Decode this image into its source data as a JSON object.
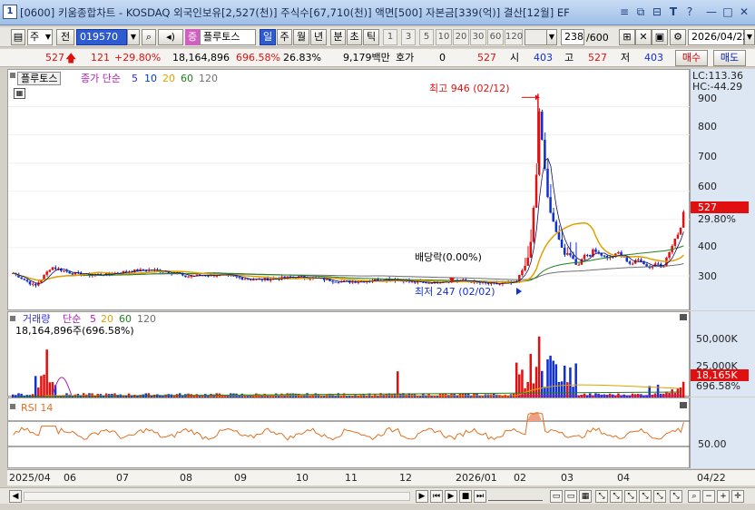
{
  "window": {
    "number": "1",
    "title": "[0600] 키움종합차트 - KOSDAQ 외국인보유[2,527(천)] 주식수[67,710(천)] 액면[500] 자본금[339(억)] 결산[12월] EF",
    "buttons": [
      "≡",
      "⧉",
      "⊟",
      "T",
      "?",
      "—",
      "□",
      "✕"
    ]
  },
  "toolbar": {
    "period_select": "주",
    "prev_label": "전",
    "code": "019570",
    "item_name": "플루토스",
    "timeframes": [
      "일",
      "주",
      "월",
      "년",
      "분",
      "초",
      "틱"
    ],
    "intervals": [
      "1",
      "3",
      "5",
      "10",
      "20",
      "30",
      "60",
      "120"
    ],
    "count_value": "238",
    "count_total": "/600",
    "date": "2026/04/22"
  },
  "quote": {
    "price": "527",
    "change": "121",
    "change_pct": "+29.80%",
    "volume": "18,164,896",
    "vol_ratio": "696.58%",
    "turnover": "26.83%",
    "amount": "9,179백만",
    "hoga_label": "호가",
    "hoga_value": "0",
    "price2": "527",
    "open_label": "시",
    "open": "403",
    "high_label": "고",
    "high": "527",
    "low_label": "저",
    "low": "403",
    "buy_label": "매수",
    "sell_label": "매도"
  },
  "price_panel": {
    "legend_name": "플루토스",
    "legend_ma": "종가 단순",
    "ma_periods": [
      "5",
      "10",
      "20",
      "60",
      "120"
    ],
    "ma_colors": [
      "#3030d0",
      "#e07000",
      "#d0d000",
      "#008000",
      "#808080"
    ],
    "lc": "LC:113.36",
    "hc": "HC:-44.29",
    "yticks": [
      "900",
      "800",
      "700",
      "600",
      "400",
      "300"
    ],
    "current_price": "527",
    "current_change": "29.80%",
    "annotation_high": "최고 946 (02/12)",
    "annotation_low": "최저 247 (02/02)",
    "annotation_dividend": "배당락(0.00%)"
  },
  "volume_panel": {
    "legend_name": "거래량",
    "legend_ma": "단순",
    "ma_periods": [
      "5",
      "20",
      "60",
      "120"
    ],
    "value_text": "18,164,896주(696.58%)",
    "yticks": [
      "50,000K",
      "25,000K"
    ],
    "current": "18,165K",
    "current_pct": "696.58%"
  },
  "rsi_panel": {
    "legend_name": "RSI 14",
    "ytick": "50.00"
  },
  "xaxis": {
    "labels": [
      "2025/04",
      "06",
      "07",
      "08",
      "09",
      "10",
      "11",
      "12",
      "2026/01",
      "02",
      "03",
      "04"
    ],
    "right_label": "04/22"
  },
  "chart_data": {
    "type": "candlestick",
    "title": "",
    "ylim": [
      200,
      1000
    ],
    "annotations": [
      {
        "text": "최고 946 (02/12)",
        "value": 946,
        "date": "02/12"
      },
      {
        "text": "최저 247 (02/02)",
        "value": 247,
        "date": "02/02"
      }
    ],
    "last": {
      "price": 527,
      "change_pct": 29.8,
      "volume_k": 18165
    }
  },
  "colors": {
    "up": "#e01010",
    "down": "#1030d0",
    "ma5": "#3030d0",
    "ma20": "#e0a000",
    "ma60": "#208020",
    "ma120": "#707070",
    "rsi": "#e07020",
    "axis_bg": "#dde6f3"
  }
}
